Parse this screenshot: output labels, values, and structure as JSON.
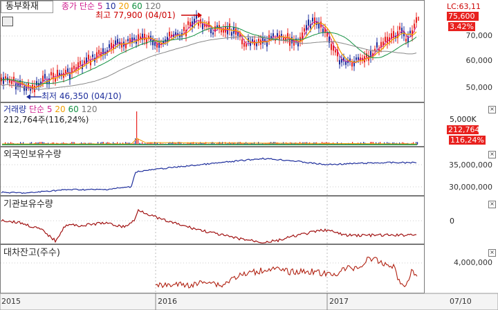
{
  "stock": {
    "name": "동부화재"
  },
  "price_legend": {
    "label": "종가 단순",
    "ma5": "5",
    "ma10": "10",
    "ma20": "20",
    "ma60": "60",
    "ma120": "120"
  },
  "annotations": {
    "high": "최고 77,900 (04/01)",
    "low": "최저 46,350 (04/10)"
  },
  "price_axis": {
    "lc": "LC:63,11",
    "current": "75,600",
    "change": "3.42%",
    "ticks": [
      "70,000",
      "60,000",
      "50,000"
    ]
  },
  "volume_legend": {
    "label": "거래량",
    "label2": "단순",
    "ma5": "5",
    "ma20": "20",
    "ma60": "60",
    "ma120": "120",
    "value": "212,764주(116,24%)"
  },
  "volume_axis": {
    "tick": "5,000K",
    "current": "212,764",
    "pct": "116,24%"
  },
  "foreign": {
    "title": "외국인보유수량",
    "ticks": [
      "35,000,000",
      "30,000,000"
    ]
  },
  "inst": {
    "title": "기관보유수량",
    "ticks": [
      "0"
    ]
  },
  "loan": {
    "title": "대차잔고(주수)",
    "ticks": [
      "4,000,000"
    ]
  },
  "dates": [
    "2015",
    "2016",
    "2017",
    "07/10"
  ],
  "colors": {
    "red": "#e8211e",
    "blue": "#1e2e9c",
    "ma5": "#d02090",
    "ma20": "#f0a000",
    "ma60": "#109040",
    "ma120": "#888888",
    "loan": "#b02010"
  },
  "chart_data": [
    {
      "type": "line",
      "title": "종가 단순",
      "series": [
        {
          "name": "종가",
          "x": [
            "2015",
            "2016",
            "2017",
            "07/10"
          ],
          "values": [
            50000,
            72000,
            70000,
            75600
          ]
        }
      ],
      "ylim": [
        45000,
        80000
      ]
    },
    {
      "type": "bar",
      "title": "거래량",
      "series": [
        {
          "name": "거래량",
          "values": [
            212764
          ]
        }
      ]
    },
    {
      "type": "line",
      "title": "외국인보유수량",
      "ylim": [
        28000000,
        38000000
      ]
    },
    {
      "type": "line",
      "title": "기관보유수량"
    },
    {
      "type": "line",
      "title": "대차잔고(주수)"
    }
  ]
}
